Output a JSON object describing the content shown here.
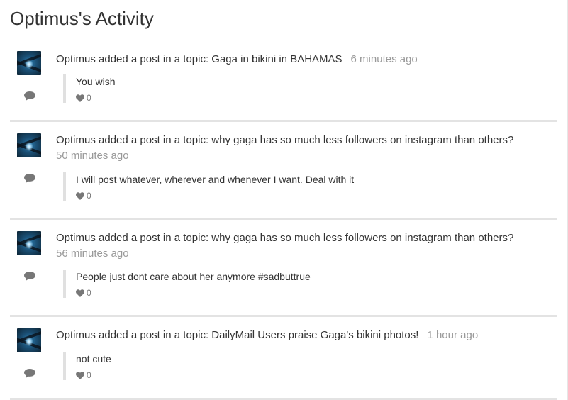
{
  "page": {
    "title": "Optimus's Activity"
  },
  "activities": [
    {
      "summary": "Optimus added a post in a topic: Gaga in bikini in BAHAMAS",
      "timestamp": "6 minutes ago",
      "post_text": "You wish",
      "likes": "0"
    },
    {
      "summary": "Optimus added a post in a topic: why gaga has so much less followers on instagram than others?",
      "timestamp": "50 minutes ago",
      "post_text": "I will post whatever, wherever and whenever I want. Deal with it",
      "likes": "0"
    },
    {
      "summary": "Optimus added a post in a topic: why gaga has so much less followers on instagram than others?",
      "timestamp": "56 minutes ago",
      "post_text": "People just dont care about her anymore #sadbuttrue",
      "likes": "0"
    },
    {
      "summary": "Optimus added a post in a topic: DailyMail Users praise Gaga's bikini photos!",
      "timestamp": "1 hour ago",
      "post_text": "not cute",
      "likes": "0"
    }
  ],
  "icons": {
    "comment": "comment-icon",
    "like": "heart-icon",
    "avatar": "avatar"
  },
  "colors": {
    "text": "#333333",
    "muted": "#999999",
    "divider": "#e3e3e3",
    "quote_bar": "#e0e0e0",
    "icon": "#777777"
  }
}
